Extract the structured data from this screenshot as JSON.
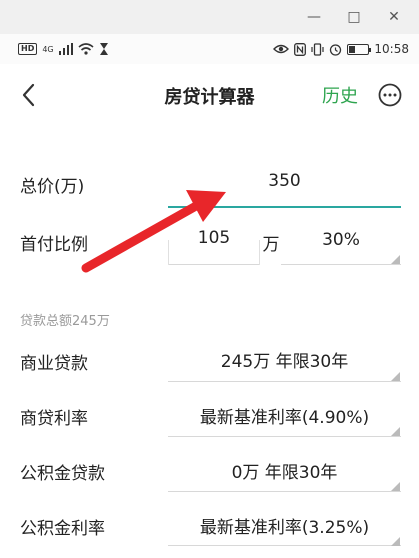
{
  "status": {
    "signal_label": "4G",
    "time": "10:58"
  },
  "nav": {
    "title": "房贷计算器",
    "history": "历史"
  },
  "form": {
    "total_price_label": "总价(万)",
    "total_price_value": "350",
    "down_payment_label": "首付比例",
    "down_payment_amount": "105",
    "down_payment_unit": "万",
    "down_payment_ratio": "30%",
    "loan_total_caption": "贷款总额245万",
    "commercial_loan_label": "商业贷款",
    "commercial_loan_value": "245万 年限30年",
    "commercial_rate_label": "商贷利率",
    "commercial_rate_value": "最新基准利率(4.90%)",
    "fund_loan_label": "公积金贷款",
    "fund_loan_value": "0万 年限30年",
    "fund_rate_label": "公积金利率",
    "fund_rate_value": "最新基准利率(3.25%)"
  },
  "colors": {
    "accent_green": "#2ea44f",
    "underline_teal": "#2aa7a0",
    "annotation_red": "#e8262a"
  }
}
